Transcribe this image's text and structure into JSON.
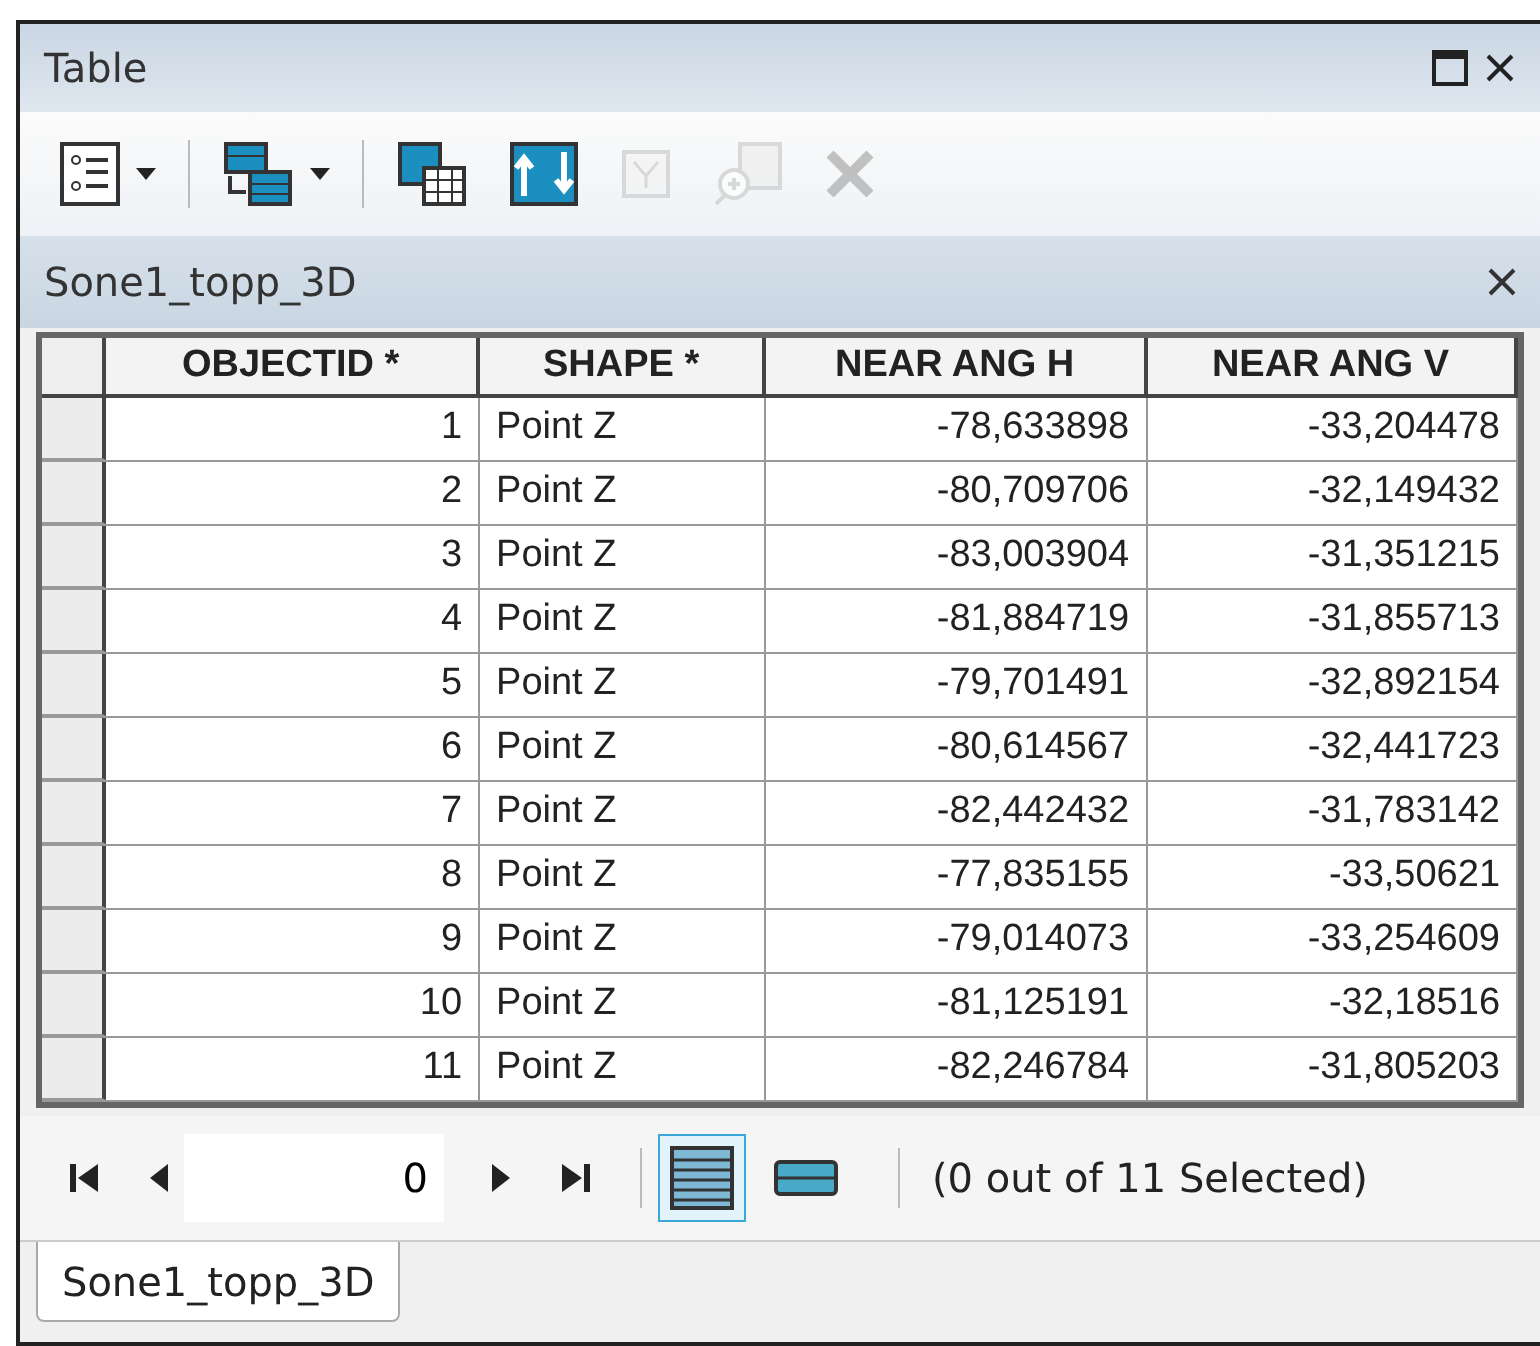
{
  "window": {
    "title": "Table"
  },
  "toolbar": [
    {
      "kind": "options",
      "disabled": false,
      "dropdown": true
    },
    {
      "kind": "related",
      "disabled": false,
      "dropdown": true
    },
    {
      "kind": "select",
      "disabled": false,
      "dropdown": false
    },
    {
      "kind": "switch",
      "disabled": false,
      "dropdown": false
    },
    {
      "kind": "clear",
      "disabled": true,
      "dropdown": false
    },
    {
      "kind": "zoom",
      "disabled": true,
      "dropdown": false
    },
    {
      "kind": "delete",
      "disabled": true,
      "dropdown": false
    }
  ],
  "layer": {
    "title": "Sone1_topp_3D"
  },
  "table": {
    "columns": [
      {
        "label": "OBJECTID *",
        "kind": "number"
      },
      {
        "label": "SHAPE *",
        "kind": "text"
      },
      {
        "label": "NEAR ANG H",
        "kind": "number"
      },
      {
        "label": "NEAR ANG V",
        "kind": "number"
      }
    ],
    "rows": [
      {
        "cells": [
          "1",
          "Point Z",
          "-78,633898",
          "-33,204478"
        ],
        "selected": false
      },
      {
        "cells": [
          "2",
          "Point Z",
          "-80,709706",
          "-32,149432"
        ],
        "selected": false
      },
      {
        "cells": [
          "3",
          "Point Z",
          "-83,003904",
          "-31,351215"
        ],
        "selected": false
      },
      {
        "cells": [
          "4",
          "Point Z",
          "-81,884719",
          "-31,855713"
        ],
        "selected": false
      },
      {
        "cells": [
          "5",
          "Point Z",
          "-79,701491",
          "-32,892154"
        ],
        "selected": false
      },
      {
        "cells": [
          "6",
          "Point Z",
          "-80,614567",
          "-32,441723"
        ],
        "selected": false
      },
      {
        "cells": [
          "7",
          "Point Z",
          "-82,442432",
          "-31,783142"
        ],
        "selected": false
      },
      {
        "cells": [
          "8",
          "Point Z",
          "-77,835155",
          "-33,50621"
        ],
        "selected": false
      },
      {
        "cells": [
          "9",
          "Point Z",
          "-79,014073",
          "-33,254609"
        ],
        "selected": false
      },
      {
        "cells": [
          "10",
          "Point Z",
          "-81,125191",
          "-32,18516"
        ],
        "selected": false
      },
      {
        "cells": [
          "11",
          "Point Z",
          "-82,246784",
          "-31,805203"
        ],
        "selected": false
      }
    ]
  },
  "navigator": {
    "record": "0",
    "views": [
      {
        "kind": "all",
        "selected": true
      },
      {
        "kind": "selected",
        "selected": false
      }
    ],
    "status": "(0 out of 11 Selected)"
  },
  "tabs": [
    {
      "label": "Sone1_topp_3D",
      "selected": true
    }
  ]
}
